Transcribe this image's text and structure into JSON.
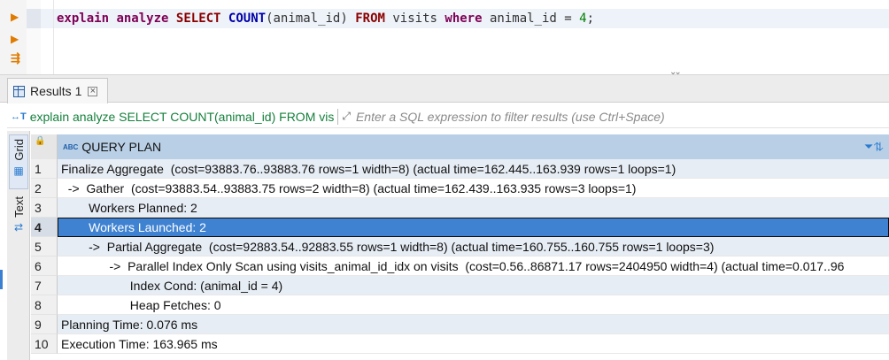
{
  "editor": {
    "query_tokens": [
      {
        "t": "explain",
        "c": "kw"
      },
      {
        "t": " ",
        "c": "plain"
      },
      {
        "t": "analyze",
        "c": "kw"
      },
      {
        "t": " ",
        "c": "plain"
      },
      {
        "t": "SELECT",
        "c": "kw2"
      },
      {
        "t": " ",
        "c": "plain"
      },
      {
        "t": "COUNT",
        "c": "fn"
      },
      {
        "t": "(animal_id) ",
        "c": "plain"
      },
      {
        "t": "FROM",
        "c": "kw2"
      },
      {
        "t": " visits ",
        "c": "plain"
      },
      {
        "t": "where",
        "c": "kw"
      },
      {
        "t": " animal_id = ",
        "c": "plain"
      },
      {
        "t": "4",
        "c": "num"
      },
      {
        "t": ";",
        "c": "plain"
      }
    ]
  },
  "results_tab": {
    "label": "Results 1",
    "close": "☒"
  },
  "filter": {
    "sql_icon": "↔T",
    "sql_text": "explain analyze SELECT COUNT(animal_id) FROM vis",
    "expand_icon": "⤢",
    "placeholder": "Enter a SQL expression to filter results (use Ctrl+Space)"
  },
  "side_tabs": {
    "grid_label": "Grid",
    "text_label": "Text"
  },
  "grid": {
    "column_type": "ABC",
    "column_name": "QUERY PLAN",
    "rows": [
      {
        "n": "1",
        "text": "Finalize Aggregate  (cost=93883.76..93883.76 rows=1 width=8) (actual time=162.445..163.939 rows=1 loops=1)"
      },
      {
        "n": "2",
        "text": "  ->  Gather  (cost=93883.54..93883.75 rows=2 width=8) (actual time=162.439..163.935 rows=3 loops=1)"
      },
      {
        "n": "3",
        "text": "        Workers Planned: 2"
      },
      {
        "n": "4",
        "text": "        Workers Launched: 2"
      },
      {
        "n": "5",
        "text": "        ->  Partial Aggregate  (cost=92883.54..92883.55 rows=1 width=8) (actual time=160.755..160.755 rows=1 loops=3)"
      },
      {
        "n": "6",
        "text": "              ->  Parallel Index Only Scan using visits_animal_id_idx on visits  (cost=0.56..86871.17 rows=2404950 width=4) (actual time=0.017..96"
      },
      {
        "n": "7",
        "text": "                    Index Cond: (animal_id = 4)"
      },
      {
        "n": "8",
        "text": "                    Heap Fetches: 0"
      },
      {
        "n": "9",
        "text": "Planning Time: 0.076 ms"
      },
      {
        "n": "10",
        "text": "Execution Time: 163.965 ms"
      }
    ],
    "selected_row": 4
  },
  "colors": {
    "selection": "#3f82d1",
    "alt_row": "#e7edf5",
    "header": "#b9cfe6",
    "filter_sql": "#15803d"
  }
}
